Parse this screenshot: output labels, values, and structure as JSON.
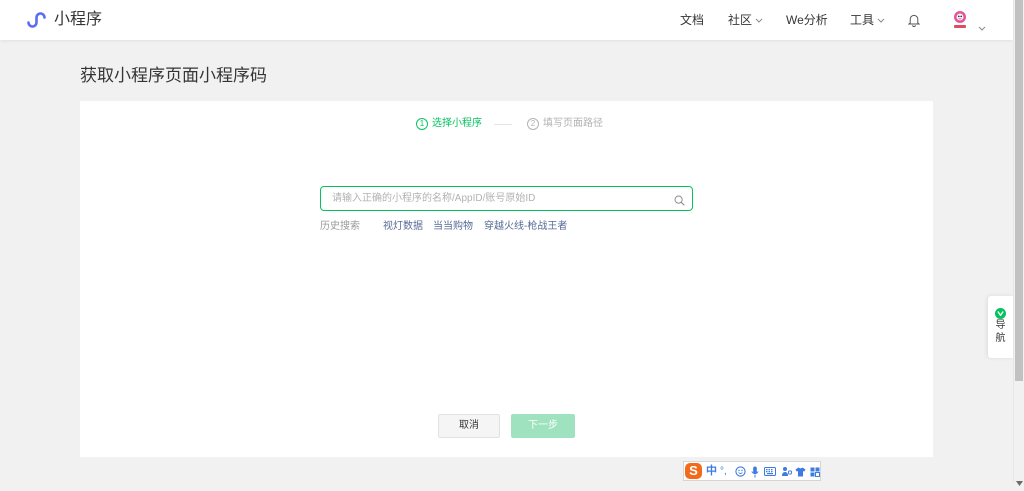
{
  "header": {
    "brand": "小程序",
    "nav": [
      {
        "label": "文档"
      },
      {
        "label": "社区"
      },
      {
        "label": "We分析"
      },
      {
        "label": "工具"
      }
    ]
  },
  "page": {
    "title": "获取小程序页面小程序码"
  },
  "steps": [
    {
      "number": "1",
      "label": "选择小程序",
      "active": true
    },
    {
      "number": "2",
      "label": "填写页面路径",
      "active": false
    }
  ],
  "search": {
    "placeholder": "请输入正确的小程序的名称/AppID/账号原始ID",
    "value": ""
  },
  "history": {
    "label": "历史搜索",
    "items": [
      "视灯数据",
      "当当购物",
      "穿越火线-枪战王者"
    ]
  },
  "buttons": {
    "cancel": "取消",
    "next": "下一步",
    "next_disabled": true
  },
  "side_nav": {
    "chars": [
      "导",
      "航"
    ]
  },
  "ime": {
    "logo": "S",
    "mode": "中",
    "punct": "°,"
  },
  "scrollbar": {
    "position_fraction": 0.0,
    "visible_fraction": 0.79
  },
  "colors": {
    "accent": "#07c160",
    "link": "#576b95",
    "disabled_button": "#9fe2bf",
    "brand_logo": "#5a6cf2",
    "ime_icon": "#3d7be0",
    "ime_logo": "#f26b1d"
  }
}
